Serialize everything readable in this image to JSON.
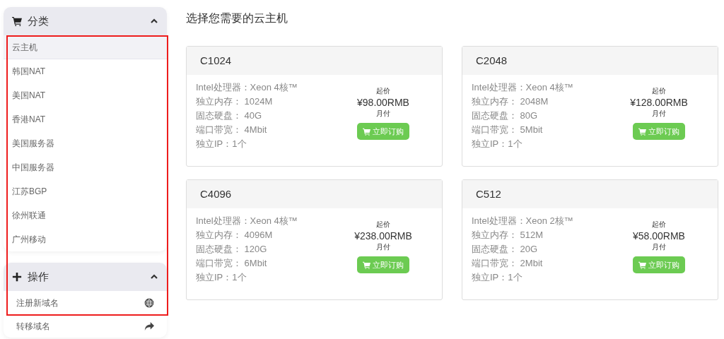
{
  "sidebar": {
    "panels": [
      {
        "title": "分类",
        "expanded": true,
        "items": [
          {
            "label": "云主机",
            "selected": true
          },
          {
            "label": "韩国NAT",
            "selected": false
          },
          {
            "label": "美国NAT",
            "selected": false
          },
          {
            "label": "香港NAT",
            "selected": false
          },
          {
            "label": "美国服务器",
            "selected": false
          },
          {
            "label": "中国服务器",
            "selected": false
          },
          {
            "label": "江苏BGP",
            "selected": false
          },
          {
            "label": "徐州联通",
            "selected": false
          },
          {
            "label": "广州移动",
            "selected": false
          }
        ]
      },
      {
        "title": "操作",
        "expanded": true,
        "items": [
          {
            "label": "注册新域名",
            "selected": false
          },
          {
            "label": "转移域名",
            "selected": false
          }
        ]
      }
    ]
  },
  "heading": "选择您需要的云主机",
  "products": [
    {
      "name": "C1024",
      "specs": [
        "Intel处理器：Xeon 4核™",
        "独立内存： 1024M",
        "固态硬盘： 40G",
        "端口带宽： 4Mbit",
        "独立IP：1个"
      ],
      "price_label": "起价",
      "price": "¥98.00RMB",
      "period": "月付",
      "button": "立即订购"
    },
    {
      "name": "C2048",
      "specs": [
        "Intel处理器：Xeon 4核™",
        "独立内存： 2048M",
        "固态硬盘： 80G",
        "端口带宽： 5Mbit",
        "独立IP：1个"
      ],
      "price_label": "起价",
      "price": "¥128.00RMB",
      "period": "月付",
      "button": "立即订购"
    },
    {
      "name": "C4096",
      "specs": [
        "Intel处理器：Xeon 4核™",
        "独立内存： 4096M",
        "固态硬盘： 120G",
        "端口带宽： 6Mbit",
        "独立IP：1个"
      ],
      "price_label": "起价",
      "price": "¥238.00RMB",
      "period": "月付",
      "button": "立即订购"
    },
    {
      "name": "C512",
      "specs": [
        "Intel处理器：Xeon 2核™",
        "独立内存： 512M",
        "固态硬盘： 20G",
        "端口带宽： 2Mbit",
        "独立IP：1个"
      ],
      "price_label": "起价",
      "price": "¥58.00RMB",
      "period": "月付",
      "button": "立即订购"
    }
  ]
}
